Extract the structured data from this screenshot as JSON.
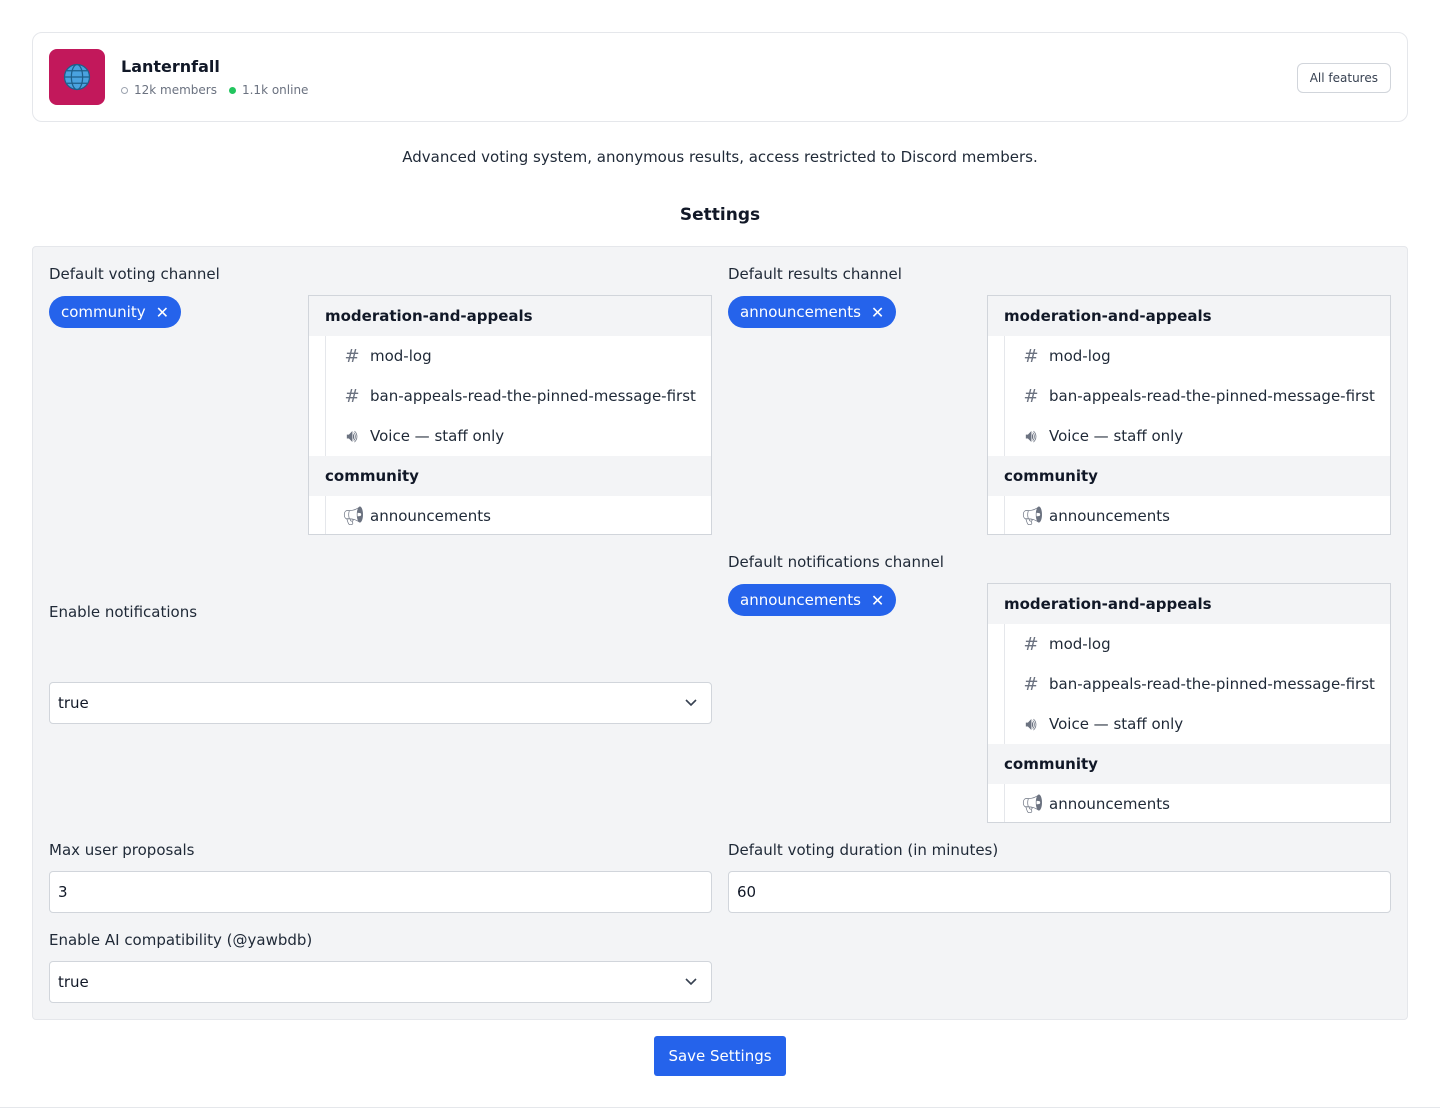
{
  "server": {
    "name": "Lanternfall",
    "members": "12k members",
    "online": "1.1k online",
    "icon_color": "#c2185b",
    "all_features_label": "All features"
  },
  "description": "Advanced voting system, anonymous results, access restricted to Discord members.",
  "settings_title": "Settings",
  "fields": {
    "voting_channel": {
      "label": "Default voting channel",
      "selected": "community"
    },
    "results_channel": {
      "label": "Default results channel",
      "selected": "announcements"
    },
    "notifications_channel": {
      "label": "Default notifications channel",
      "selected": "announcements"
    },
    "enable_notifications": {
      "label": "Enable notifications",
      "value": "true"
    },
    "max_proposals": {
      "label": "Max user proposals",
      "value": "3"
    },
    "voting_duration": {
      "label": "Default voting duration (in minutes)",
      "value": "60"
    },
    "ai_compat": {
      "label": "Enable AI compatibility (@yawbdb)",
      "value": "true"
    }
  },
  "channels": {
    "category_1": "moderation-and-appeals",
    "mod_log": "mod-log",
    "ban_appeals": "ban-appeals-read-the-pinned-message-first",
    "voice": "Voice — staff only",
    "category_2": "community",
    "announcements": "announcements"
  },
  "save_label": "Save Settings",
  "accent": "#2563eb"
}
